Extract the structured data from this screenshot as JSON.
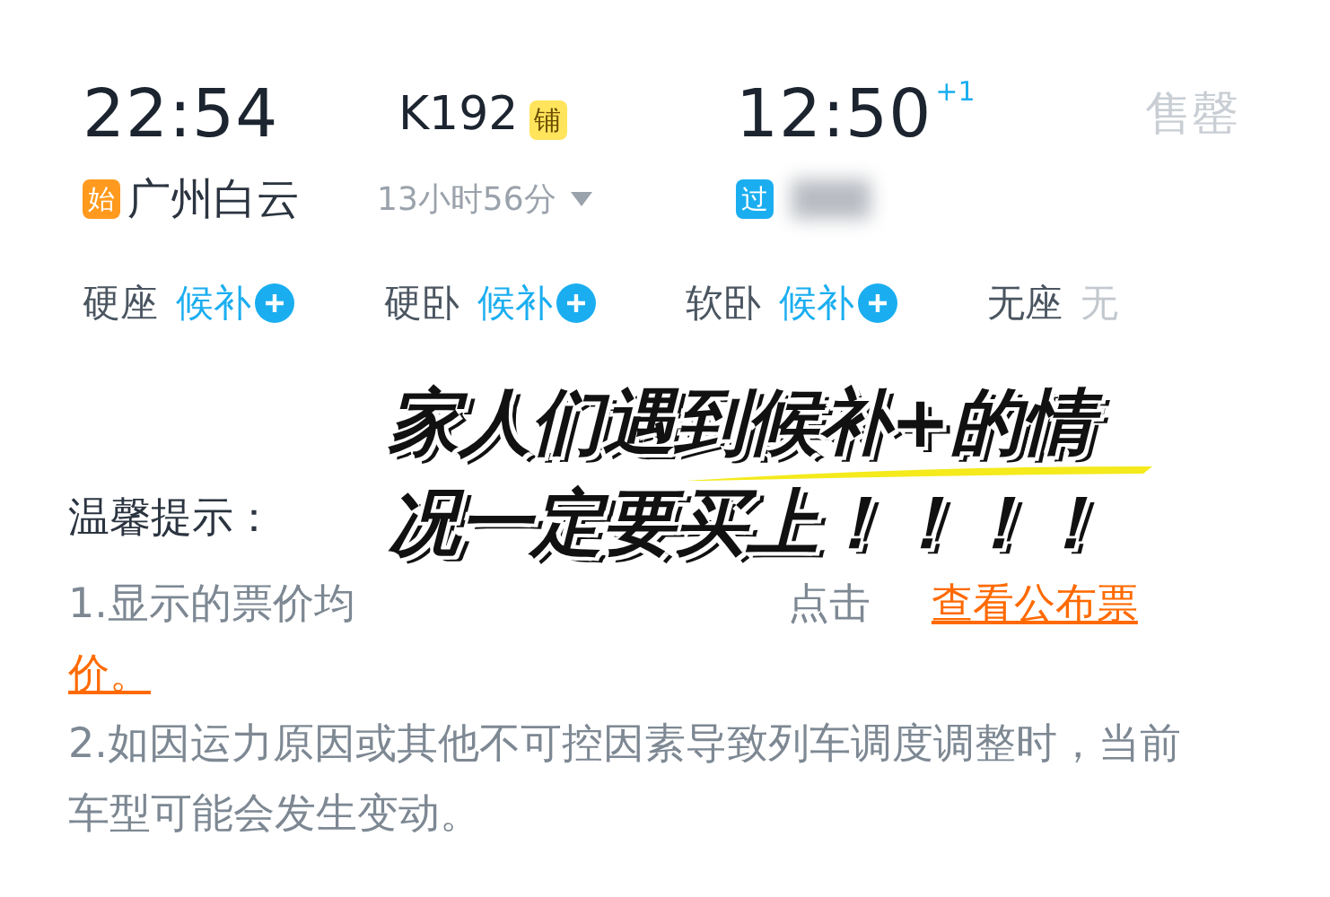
{
  "departure": {
    "time": "22:54",
    "badge": {
      "text": "始",
      "color": "#ff9a1e"
    },
    "station": "广州白云"
  },
  "train": {
    "number": "K192",
    "badge": {
      "text": "铺",
      "color": "#ffe45c"
    },
    "duration": "13小时56分"
  },
  "arrival": {
    "time": "12:50",
    "day_offset": "+1",
    "badge": {
      "text": "过",
      "color": "#1aaef0"
    }
  },
  "status": "售罄",
  "seats": [
    {
      "class": "硬座",
      "availability": "候补",
      "kind": "waitlist"
    },
    {
      "class": "硬卧",
      "availability": "候补",
      "kind": "waitlist"
    },
    {
      "class": "软卧",
      "availability": "候补",
      "kind": "waitlist"
    },
    {
      "class": "无座",
      "availability": "无",
      "kind": "none"
    }
  ],
  "notice": {
    "title": "温馨提示：",
    "items": [
      {
        "segments": [
          {
            "kind": "text",
            "text": "1.显示的票价均"
          },
          {
            "kind": "gap"
          },
          {
            "kind": "text",
            "text": "点击"
          },
          {
            "kind": "link",
            "text": "查看公布票"
          },
          {
            "kind": "link",
            "text": "价。"
          }
        ]
      },
      {
        "segments": [
          {
            "kind": "text",
            "text": "2.如因运力原因或其他不可控因素导致列车调度调整时，当前车型可能会发生变动。"
          }
        ]
      }
    ]
  },
  "caption": {
    "lines": [
      "家人们遇到候补+的情",
      "况一定要买上！！！！"
    ]
  }
}
